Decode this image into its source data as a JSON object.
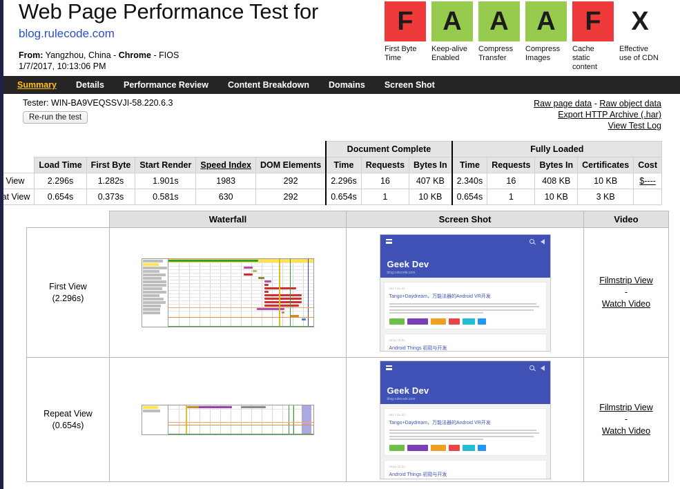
{
  "header": {
    "title": "Web Page Performance Test for",
    "site_url": "blog.rulecode.com",
    "from_label": "From:",
    "from_value": " Yangzhou, China - ",
    "browser": "Chrome",
    "connection": " - FIOS",
    "timestamp": "1/7/2017, 10:13:06 PM"
  },
  "grades": [
    {
      "letter": "F",
      "label": "First Byte Time",
      "color": "#ee3a3a"
    },
    {
      "letter": "A",
      "label": "Keep-alive Enabled",
      "color": "#96cb4e"
    },
    {
      "letter": "A",
      "label": "Compress Transfer",
      "color": "#96cb4e"
    },
    {
      "letter": "A",
      "label": "Compress Images",
      "color": "#96cb4e"
    },
    {
      "letter": "F",
      "label": "Cache static content",
      "color": "#ee3a3a"
    },
    {
      "letter": "X",
      "label": "Effective use of CDN",
      "color": "transparent"
    }
  ],
  "nav": {
    "items": [
      {
        "label": "Summary",
        "active": true
      },
      {
        "label": "Details",
        "active": false
      },
      {
        "label": "Performance Review",
        "active": false
      },
      {
        "label": "Content Breakdown",
        "active": false
      },
      {
        "label": "Domains",
        "active": false
      },
      {
        "label": "Screen Shot",
        "active": false
      }
    ]
  },
  "subbar": {
    "tester": "Tester: WIN-BA9VEQSSVJI-58.220.6.3",
    "rerun_label": "Re-run the test",
    "links": {
      "raw_page_data": "Raw page data",
      "separator": " - ",
      "raw_object_data": "Raw object data",
      "export_har": "Export HTTP Archive (.har)",
      "view_test_log": "View Test Log"
    }
  },
  "metrics_table": {
    "group_headers": {
      "document_complete": "Document Complete",
      "fully_loaded": "Fully Loaded"
    },
    "columns": [
      "Load Time",
      "First Byte",
      "Start Render",
      "Speed Index",
      "DOM Elements",
      "Time",
      "Requests",
      "Bytes In",
      "Time",
      "Requests",
      "Bytes In",
      "Certificates",
      "Cost"
    ],
    "rows": [
      {
        "label": "First View",
        "cells": [
          "2.296s",
          "1.282s",
          "1.901s",
          "1983",
          "292",
          "2.296s",
          "16",
          "407 KB",
          "2.340s",
          "16",
          "408 KB",
          "10 KB",
          "$----"
        ]
      },
      {
        "label": "Repeat View",
        "cells": [
          "0.654s",
          "0.373s",
          "0.581s",
          "630",
          "292",
          "0.654s",
          "1",
          "10 KB",
          "0.654s",
          "1",
          "10 KB",
          "3 KB",
          ""
        ]
      }
    ]
  },
  "results_table": {
    "headers": {
      "blank": "",
      "waterfall": "Waterfall",
      "screenshot": "Screen Shot",
      "video": "Video"
    },
    "rows": [
      {
        "view": "First View",
        "time": "(2.296s)",
        "video": {
          "filmstrip": "Filmstrip View",
          "dash": "-",
          "watch": "Watch Video"
        }
      },
      {
        "view": "Repeat View",
        "time": "(0.654s)",
        "video": {
          "filmstrip": "Filmstrip View",
          "dash": "-",
          "watch": "Watch Video"
        }
      }
    ]
  },
  "screenshot_preview": {
    "brand": "Geek Dev",
    "tagline": "blog.rulecode.com",
    "article1": {
      "date": "2017-01-02",
      "title": "Tango+Daydream，万能法器的Android VR开发"
    },
    "article2": {
      "date": "2016-12-22",
      "title": "Android Things 初窥与开发"
    },
    "tag_colors": [
      "#6cc04a",
      "#7b3fb5",
      "#f0a020",
      "#e8454a",
      "#22bcd4",
      "#2196f3"
    ]
  },
  "theme": {
    "nav_bg": "#272425",
    "nav_active": "#ffc20e",
    "left_border": "#20214a",
    "link_blue": "#2a50c8",
    "screenshot_header": "#3f51b5"
  }
}
